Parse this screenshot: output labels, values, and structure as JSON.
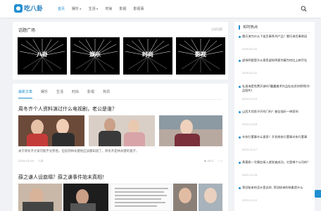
{
  "header": {
    "logo_text": "吃八卦",
    "nav": [
      {
        "label": "首页",
        "active": true,
        "caret": false
      },
      {
        "label": "娱乐",
        "active": false,
        "caret": true
      },
      {
        "label": "生活",
        "active": false,
        "caret": true
      },
      {
        "label": "时尚",
        "active": false,
        "caret": false
      },
      {
        "label": "影视",
        "active": false,
        "caret": false
      },
      {
        "label": "影视事",
        "active": false,
        "caret": false
      }
    ],
    "search_icon": "search-icon"
  },
  "topics": {
    "title": "话题广场",
    "more": "全部话题",
    "items": [
      "八卦",
      "娱乐",
      "时尚",
      "影视"
    ]
  },
  "articles": {
    "tabs": [
      "最新文章",
      "娱乐",
      "生活",
      "时尚",
      "影视",
      "热讯"
    ],
    "active_tab": "最新文章",
    "list": [
      {
        "title": "周冬齐个人资料演过什么电视剧，老公是谁？",
        "summary": "关于周冬齐大家可能不太熟悉，但说到林永健他应该都知道了，周冬齐是林永健的妻子，",
        "date": "2024-02-04",
        "category": "八卦",
        "views": "4871",
        "likes": "1"
      },
      {
        "title": "薛之谦人设崩塌？薛之谦事件始末真相！"
      }
    ]
  },
  "sidebar": {
    "title": "实时热点",
    "items": [
      {
        "title": "雷乐海为什么下架百事系列产品？雷乐海百事原因",
        "date": "2024-01-05"
      },
      {
        "title": "虚拟明星是什么意思虚拟明星你骗为何红上新华社",
        "date": "2024-01-02"
      },
      {
        "title": "杜昌海是免费开放吗?露露美术作品杜欢虎你得得(作品图片)",
        "date": "2023-12-29"
      },
      {
        "title": "山西大同男子开的门吗？被告强奸一审获刑",
        "date": "2023-12-28"
      },
      {
        "title": "辛执行董事什么意思？开发商执行董事辛执行董事",
        "date": "2023-12-27"
      },
      {
        "title": "黄慕帆一号舞台接入就发被成功，它是哪个公司的？",
        "date": "2023-12-26"
      },
      {
        "title": "荣冠秘来的坚计是这样, 荣冠秘来的装备是什么",
        "date": "2023-12-25"
      }
    ]
  }
}
